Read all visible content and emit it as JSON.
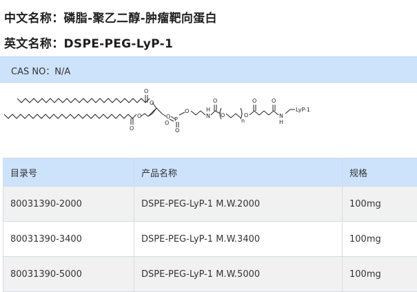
{
  "chinese_name": "中文名称：磷脂-聚乙二醇-肿瘤靶向蛋白",
  "english_name": "英文名称：DSPE-PEG-LyP-1",
  "cas": "CAS NO：N/A",
  "structure_labels": {
    "ligand": "LyP-1",
    "repeat": "n",
    "oxygen": "O",
    "phosphorus": "P",
    "nitrogen": "N",
    "hydrogen": "H"
  },
  "table": {
    "headers": [
      "目录号",
      "产品名称",
      "规格"
    ],
    "rows": [
      [
        "80031390-2000",
        "DSPE-PEG-LyP-1 M.W.2000",
        "100mg"
      ],
      [
        "80031390-3400",
        "DSPE-PEG-LyP-1 M.W.3400",
        "100mg"
      ],
      [
        "80031390-5000",
        "DSPE-PEG-LyP-1 M.W.5000",
        "100mg"
      ]
    ]
  }
}
